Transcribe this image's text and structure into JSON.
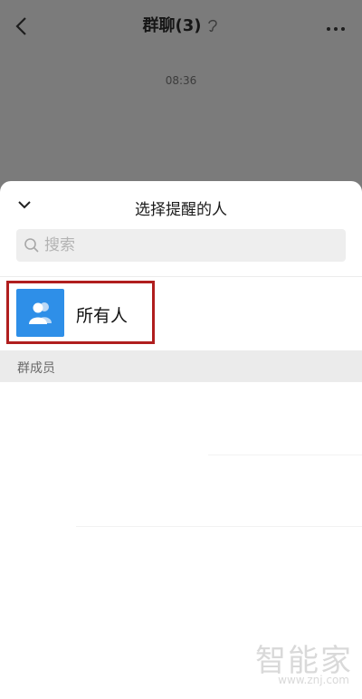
{
  "chat": {
    "title": "群聊(3)",
    "timestamp": "08:36"
  },
  "sheet": {
    "title": "选择提醒的人",
    "search_placeholder": "搜索",
    "everyone_label": "所有人",
    "section_label": "群成员"
  },
  "watermark": {
    "brand": "智能家",
    "url": "www.znj.com"
  },
  "colors": {
    "avatar_bg": "#2e8fe8",
    "highlight": "#b01e1e"
  }
}
